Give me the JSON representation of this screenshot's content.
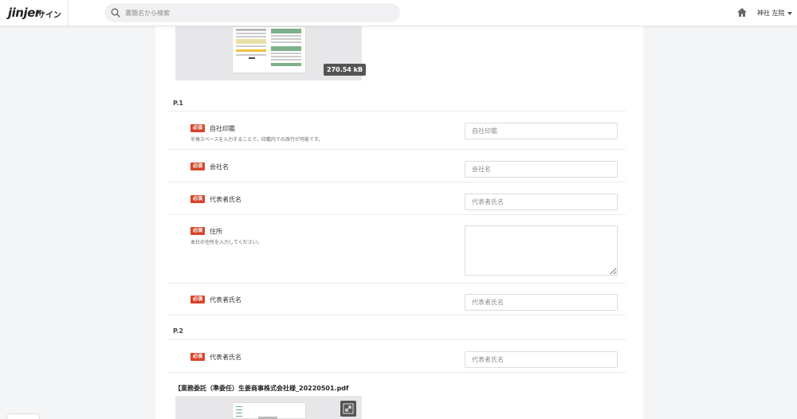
{
  "header": {
    "logo": "jinjer",
    "logo_sub": "サイン",
    "search_placeholder": "書類名から検索",
    "user_name": "神社 左院"
  },
  "preview_top": {
    "file_size": "270.54 kB"
  },
  "sections": [
    {
      "title": "P.1",
      "fields": [
        {
          "required": "必須",
          "label": "自社印鑑",
          "help": "半角スペースを入力することで、印鑑内での改行が可能です。",
          "placeholder": "自社印鑑",
          "type": "input"
        },
        {
          "required": "必須",
          "label": "会社名",
          "help": "",
          "placeholder": "会社名",
          "type": "input"
        },
        {
          "required": "必須",
          "label": "代表者氏名",
          "help": "",
          "placeholder": "代表者氏名",
          "type": "input"
        },
        {
          "required": "必須",
          "label": "住所",
          "help": "本社の住所を入力してください。",
          "placeholder": "",
          "type": "textarea"
        },
        {
          "required": "必須",
          "label": "代表者氏名",
          "help": "",
          "placeholder": "代表者氏名",
          "type": "input"
        }
      ]
    },
    {
      "title": "P.2",
      "fields": [
        {
          "required": "必須",
          "label": "代表者氏名",
          "help": "",
          "placeholder": "代表者氏名",
          "type": "input"
        }
      ]
    }
  ],
  "second_file": {
    "name": "【業務委託（準委任）生姜商事株式会社様_20220501.pdf"
  },
  "icons": {
    "search": "search-icon",
    "home": "home-icon",
    "caret": "chevron-down-icon",
    "expand": "expand-icon"
  }
}
